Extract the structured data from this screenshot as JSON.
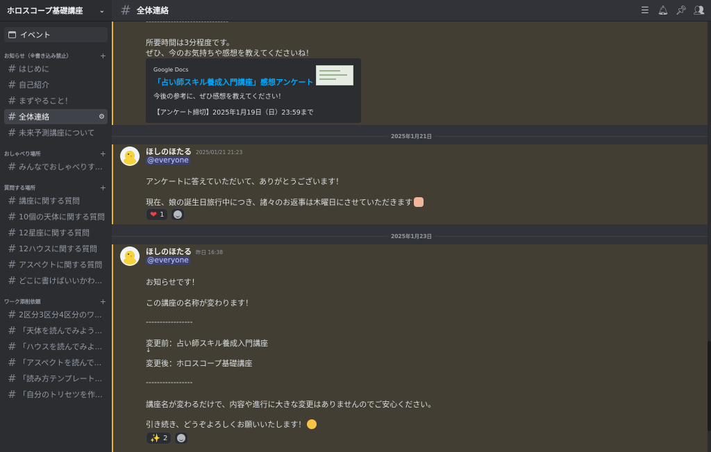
{
  "server": {
    "name": "ホロスコープ基礎講座"
  },
  "event_label": "イベント",
  "categories": [
    {
      "name": "お知らせ（※書き込み禁止）",
      "channels": [
        "はじめに",
        "自己紹介",
        "まずやること！",
        "全体連絡",
        "未来予測講座について"
      ]
    },
    {
      "name": "おしゃべり場所",
      "channels": [
        "みんなでおしゃべりす..."
      ]
    },
    {
      "name": "質問する場所",
      "channels": [
        "講座に関する質問",
        "10個の天体に関する質問",
        "12星座に関する質問",
        "12ハウスに関する質問",
        "アスペクトに関する質問",
        "どこに書けばいいかわ..."
      ]
    },
    {
      "name": "ワーク添削依頼",
      "channels": [
        "2区分3区分4区分のワ...",
        "「天体を読んでみよう...",
        "「ハウスを読んでみよ...",
        "「アスペクトを読んで...",
        "「読み方テンプレート...",
        "「自分のトリセツを作..."
      ]
    }
  ],
  "topbar": {
    "channel": "全体連絡"
  },
  "msg0": {
    "dashes": "------------------------------",
    "line1": "所要時間は3分程度です。",
    "line2": "ぜひ、今のお気持ちや感想を教えてくださいね！",
    "embed": {
      "provider": "Google Docs",
      "title": "「占い師スキル養成入門講座」感想アンケート",
      "desc": "今後の参考に、ぜひ感想を教えてください！",
      "deadline": "【アンケート締切】2025年1月19日（日）23:59まで"
    }
  },
  "date1": "2025年1月21日",
  "msg1": {
    "author": "ほしのほたる",
    "time": "2025/01/21 21:23",
    "mention": "@everyone",
    "line1": "アンケートに答えていただいて、ありがとうございます！",
    "line2": "現在、娘の誕生日旅行中につき、諸々のお返事は木曜日にさせていただきます",
    "reaction_count": "1"
  },
  "date2": "2025年1月23日",
  "msg2": {
    "author": "ほしのほたる",
    "time": "昨日 16:38",
    "mention": "@everyone",
    "line1": "お知らせです！",
    "line2": "この講座の名称が変わります！",
    "dashes": "-----------------",
    "before": "変更前：占い師スキル養成入門講座",
    "arrow": "↓",
    "after": "変更後：ホロスコープ基礎講座",
    "dashes2": "-----------------",
    "line3": "講座名が変わるだけで、内容や進行に大きな変更はありませんのでご安心ください。",
    "line4": "引き続き、どうぞよろしくお願いいたします！",
    "reaction_count": "2"
  },
  "colors": {
    "accent_mention": "#3c4270",
    "highlight": "#433e34",
    "highlight_bar": "#f0b232",
    "link": "#00a8fc"
  }
}
